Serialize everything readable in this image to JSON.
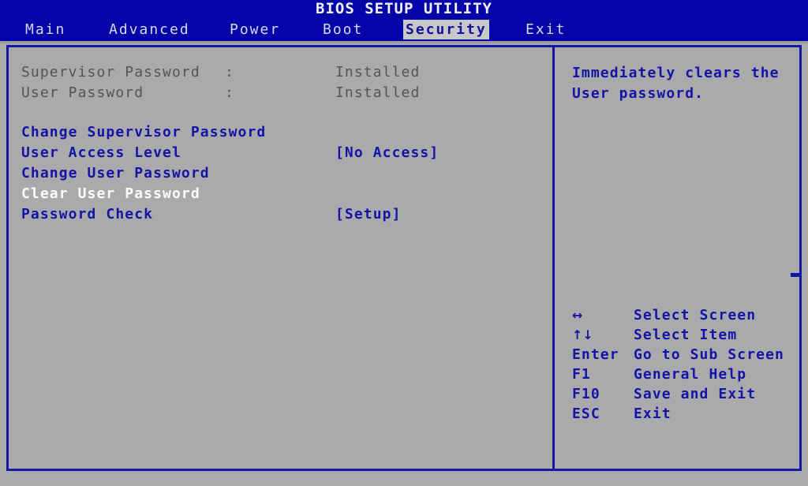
{
  "header": {
    "title": "BIOS SETUP UTILITY",
    "menu": [
      {
        "label": "Main",
        "selected": false
      },
      {
        "label": "Advanced",
        "selected": false
      },
      {
        "label": "Power",
        "selected": false
      },
      {
        "label": "Boot",
        "selected": false
      },
      {
        "label": "Security",
        "selected": true
      },
      {
        "label": "Exit",
        "selected": false
      }
    ]
  },
  "status": [
    {
      "label": "Supervisor Password",
      "colon": ":",
      "value": "Installed"
    },
    {
      "label": "User Password",
      "colon": ":",
      "value": "Installed"
    }
  ],
  "menu_items": [
    {
      "label": "Change Supervisor Password",
      "value": "",
      "state": "normal"
    },
    {
      "label": "User Access Level",
      "value": "[No Access]",
      "state": "normal"
    },
    {
      "label": "Change User Password",
      "value": "",
      "state": "normal"
    },
    {
      "label": "Clear User Password",
      "value": "",
      "state": "selected"
    },
    {
      "label": "Password Check",
      "value": "[Setup]",
      "state": "normal"
    }
  ],
  "help": {
    "text": "Immediately clears the\nUser password."
  },
  "legend": [
    {
      "key": "↔",
      "desc": "Select Screen",
      "icon": "left-right-arrow-icon"
    },
    {
      "key": "↑↓",
      "desc": "Select Item",
      "icon": "up-down-arrow-icon"
    },
    {
      "key": "Enter",
      "desc": "Go to Sub Screen",
      "icon": "enter-key"
    },
    {
      "key": "F1",
      "desc": "General Help",
      "icon": "f1-key"
    },
    {
      "key": "F10",
      "desc": "Save and Exit",
      "icon": "f10-key"
    },
    {
      "key": "ESC",
      "desc": "Exit",
      "icon": "esc-key"
    }
  ],
  "colors": {
    "header_blue": "#0404a8",
    "background_gray": "#aaaaac",
    "text_blue": "#1414a4",
    "text_dim": "#545454",
    "text_selected": "#fdfdfd",
    "tab_highlight": "#c8c8c8",
    "border_blue": "#1515a8"
  }
}
